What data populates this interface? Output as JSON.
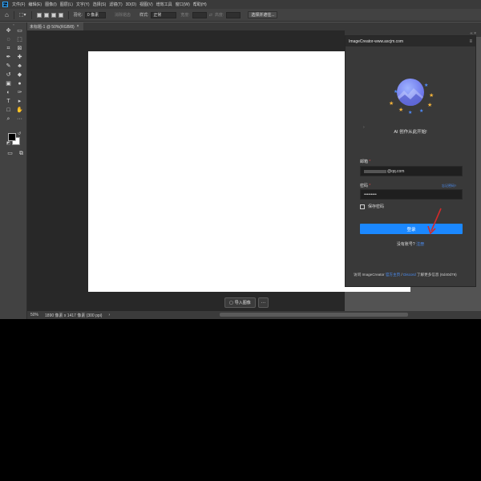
{
  "app": {
    "logo": "Ps"
  },
  "menu": [
    "文件(F)",
    "编辑(E)",
    "图像(I)",
    "图层(L)",
    "文字(Y)",
    "选择(S)",
    "滤镜(T)",
    "3D(D)",
    "视图(V)",
    "增效工具",
    "窗口(W)",
    "帮助(H)"
  ],
  "options": {
    "feather_label": "羽化:",
    "feather_value": "0 像素",
    "antialias": "消除锯齿",
    "style_label": "样式:",
    "style_value": "正常",
    "width_label": "宽度:",
    "height_label": "高度:",
    "select_mask": "选择并遮住..."
  },
  "document": {
    "tab_label": "未标题-1 @ 50%(RGB/8)",
    "tab_close": "×"
  },
  "toolbox": {
    "grip": "»",
    "tools": [
      {
        "name": "move-tool",
        "glyph": "✥"
      },
      {
        "name": "artboard-tool",
        "glyph": "▭"
      },
      {
        "name": "lasso-tool",
        "glyph": "◌"
      },
      {
        "name": "object-select-tool",
        "glyph": "⬚"
      },
      {
        "name": "crop-tool",
        "glyph": "⌗"
      },
      {
        "name": "frame-tool",
        "glyph": "⊠"
      },
      {
        "name": "eyedropper-tool",
        "glyph": "✒"
      },
      {
        "name": "healing-brush-tool",
        "glyph": "✚"
      },
      {
        "name": "brush-tool",
        "glyph": "✎"
      },
      {
        "name": "stamp-tool",
        "glyph": "♣"
      },
      {
        "name": "history-brush-tool",
        "glyph": "↺"
      },
      {
        "name": "eraser-tool",
        "glyph": "◆"
      },
      {
        "name": "gradient-tool",
        "glyph": "▣"
      },
      {
        "name": "blur-tool",
        "glyph": "●"
      },
      {
        "name": "dodge-tool",
        "glyph": "◐"
      },
      {
        "name": "pen-tool",
        "glyph": "✑"
      },
      {
        "name": "type-tool",
        "glyph": "T"
      },
      {
        "name": "path-select-tool",
        "glyph": "▸"
      },
      {
        "name": "rectangle-tool",
        "glyph": "□"
      },
      {
        "name": "hand-tool",
        "glyph": "✋"
      },
      {
        "name": "zoom-tool",
        "glyph": "⌕"
      },
      {
        "name": "more-tools",
        "glyph": "···"
      }
    ],
    "swap": "↺",
    "reset": "◩"
  },
  "import": {
    "label": "导入图像",
    "icon": "▢",
    "more": "···"
  },
  "status": {
    "zoom": "50%",
    "info": "1890 像素 x 1417 像素 (300 ppi)",
    "arrow": "›"
  },
  "panel": {
    "top_controls": "‹‹  ×",
    "tab": "ImageCreator-www.ascjm.com",
    "menu": "≡",
    "tagline": "AI 创作从此开始!",
    "email_label": "邮箱",
    "email_suffix": "@qq.com",
    "password_label": "密码",
    "password_value": "•••••••••",
    "forgot": "忘记密码?",
    "remember": "保存密码",
    "login": "登录",
    "signup_prompt": "没有账号? ",
    "signup_link": "注册",
    "footer_prefix": "访问 ImageCreator ",
    "footer_link1": "官方主页",
    "footer_sep": " / ",
    "footer_link2": "Discord",
    "footer_suffix": " 了解更多信息 (6d40d79)",
    "req_mark": "*"
  },
  "colors": {
    "accent": "#1b88ff",
    "link": "#4b8ef5",
    "logo_primary": "#6a73ea",
    "star_gold": "#f2b23a",
    "star_blue": "#4f8cff"
  }
}
